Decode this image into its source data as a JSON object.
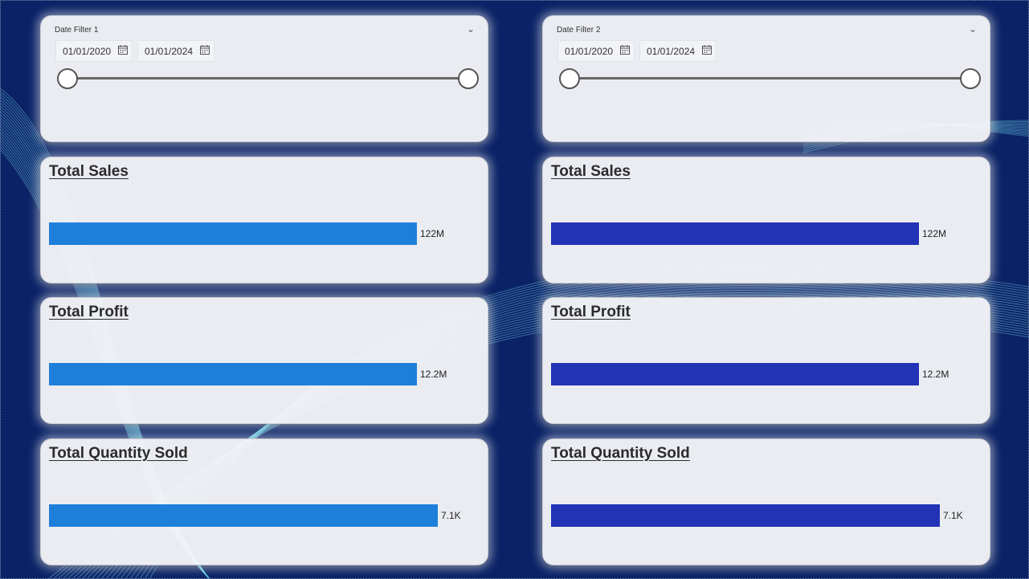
{
  "colors": {
    "background": "#0b2366",
    "card": "#f4f5f8",
    "bar_left": "#1e7fdb",
    "bar_right": "#2233b6",
    "wave": "#6fd0e6"
  },
  "filters": [
    {
      "title": "Date Filter 1",
      "start": "01/01/2020",
      "end": "01/01/2024",
      "range_fraction": [
        0,
        1
      ]
    },
    {
      "title": "Date Filter 2",
      "start": "01/01/2020",
      "end": "01/01/2024",
      "range_fraction": [
        0,
        1
      ]
    }
  ],
  "icons": {
    "calendar": "calendar-icon",
    "dropdown": "chevron-down-icon"
  },
  "panels": [
    {
      "metrics": [
        {
          "title": "Total Sales",
          "value_label": "122M",
          "fill_fraction": 0.88
        },
        {
          "title": "Total Profit",
          "value_label": "12.2M",
          "fill_fraction": 0.88
        },
        {
          "title": "Total Quantity Sold",
          "value_label": "7.1K",
          "fill_fraction": 0.93
        }
      ]
    },
    {
      "metrics": [
        {
          "title": "Total Sales",
          "value_label": "122M",
          "fill_fraction": 0.88
        },
        {
          "title": "Total Profit",
          "value_label": "12.2M",
          "fill_fraction": 0.88
        },
        {
          "title": "Total Quantity Sold",
          "value_label": "7.1K",
          "fill_fraction": 0.93
        }
      ]
    }
  ]
}
